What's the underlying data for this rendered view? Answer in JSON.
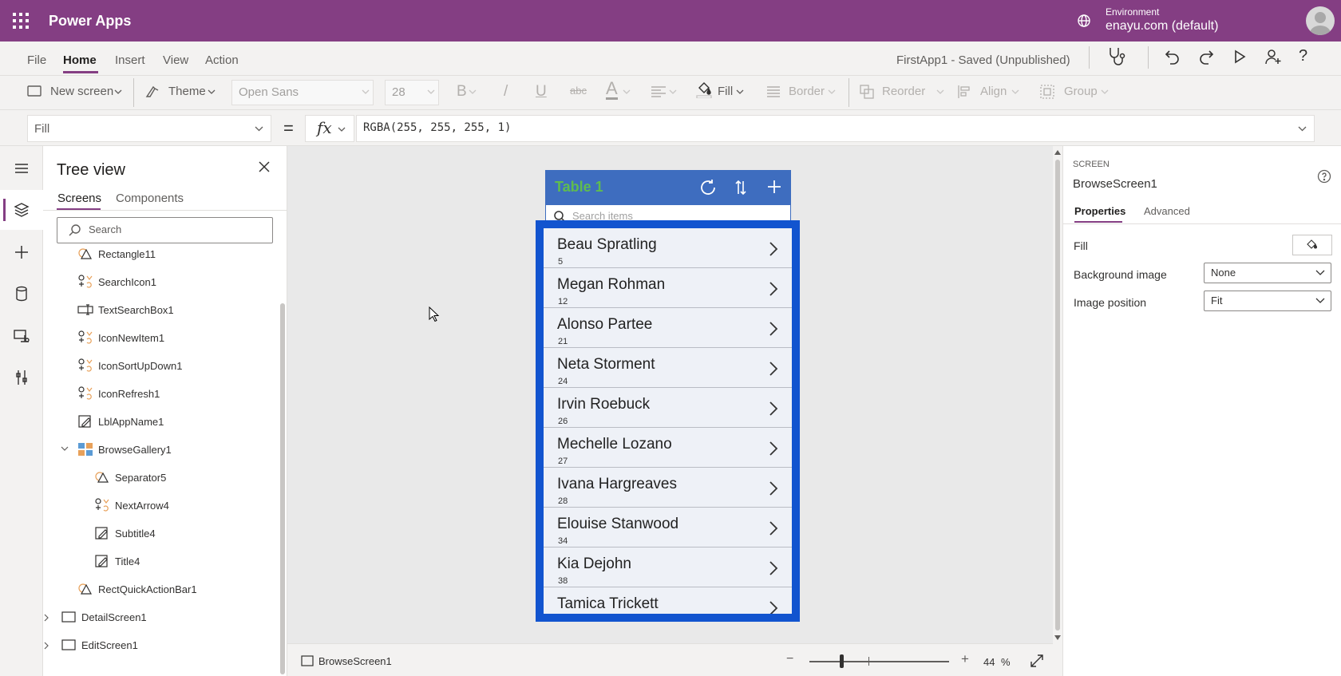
{
  "topbar": {
    "app_title": "Power Apps",
    "environment_label": "Environment",
    "environment_value": "enayu.com (default)"
  },
  "menu": {
    "items": [
      "File",
      "Home",
      "Insert",
      "View",
      "Action"
    ],
    "active": "Home",
    "saved_status": "FirstApp1 - Saved (Unpublished)"
  },
  "toolbar": {
    "new_screen": "New screen",
    "theme": "Theme",
    "font": "Open Sans",
    "font_size": "28",
    "bold": "B",
    "italic": "/",
    "underline": "U",
    "strike": "abc",
    "font_color": "A",
    "fill": "Fill",
    "border": "Border",
    "reorder": "Reorder",
    "align": "Align",
    "group": "Group"
  },
  "formula": {
    "property": "Fill",
    "equals": "=",
    "fx": "fx",
    "expression": "RGBA(255, 255, 255, 1)"
  },
  "tree": {
    "title": "Tree view",
    "tabs": [
      "Screens",
      "Components"
    ],
    "search_placeholder": "Search",
    "nodes": [
      {
        "label": "Rectangle11",
        "icon": "rectangle-icon"
      },
      {
        "label": "SearchIcon1",
        "icon": "icon-control-icon"
      },
      {
        "label": "TextSearchBox1",
        "icon": "text-input-icon"
      },
      {
        "label": "IconNewItem1",
        "icon": "icon-control-icon"
      },
      {
        "label": "IconSortUpDown1",
        "icon": "icon-control-icon"
      },
      {
        "label": "IconRefresh1",
        "icon": "icon-control-icon"
      },
      {
        "label": "LblAppName1",
        "icon": "label-icon"
      },
      {
        "label": "BrowseGallery1",
        "icon": "gallery-icon"
      },
      {
        "label": "Separator5",
        "icon": "rectangle-icon"
      },
      {
        "label": "NextArrow4",
        "icon": "icon-control-icon"
      },
      {
        "label": "Subtitle4",
        "icon": "label-icon"
      },
      {
        "label": "Title4",
        "icon": "label-icon"
      },
      {
        "label": "RectQuickActionBar1",
        "icon": "rectangle-icon"
      },
      {
        "label": "DetailScreen1",
        "icon": "screen-icon"
      },
      {
        "label": "EditScreen1",
        "icon": "screen-icon"
      }
    ]
  },
  "phone": {
    "title": "Table 1",
    "search_placeholder": "Search items",
    "gallery": [
      {
        "name": "Beau Spratling",
        "num": "5"
      },
      {
        "name": "Megan Rohman",
        "num": "12"
      },
      {
        "name": "Alonso Partee",
        "num": "21"
      },
      {
        "name": "Neta Storment",
        "num": "24"
      },
      {
        "name": "Irvin Roebuck",
        "num": "26"
      },
      {
        "name": "Mechelle Lozano",
        "num": "27"
      },
      {
        "name": "Ivana Hargreaves",
        "num": "28"
      },
      {
        "name": "Elouise Stanwood",
        "num": "34"
      },
      {
        "name": "Kia Dejohn",
        "num": "38"
      },
      {
        "name": "Tamica Trickett",
        "num": ""
      }
    ]
  },
  "footer": {
    "screen_name": "BrowseScreen1",
    "zoom_minus": "−",
    "zoom_plus": "+",
    "zoom_value": "44",
    "zoom_unit": "%"
  },
  "rpanel": {
    "kind": "SCREEN",
    "name": "BrowseScreen1",
    "tabs": [
      "Properties",
      "Advanced"
    ],
    "fill_label": "Fill",
    "bg_label": "Background image",
    "bg_value": "None",
    "pos_label": "Image position",
    "pos_value": "Fit"
  },
  "colors": {
    "brand": "#843e83",
    "header_blue": "#3e6dbf",
    "selection_blue": "#1254cf",
    "title_green": "#5fbc4f"
  }
}
